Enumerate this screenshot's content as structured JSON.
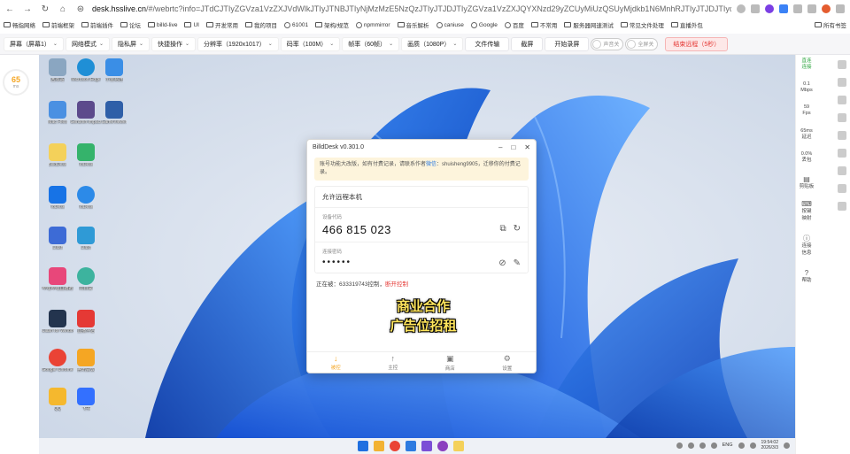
{
  "browser": {
    "url_host": "desk.hsslive.cn",
    "url_rest": "/#/webrtc?info=JTdCJTIyZGVza1VzZXJVdWlkJTIyJTNBJTIyNjMzMzE5NzQzJTIyJTJDJTIyZGVza1VzZXJQYXNzd29yZCUyMiUzQSUyMjdkb1N6MnhRJTIyJTJDJTIycmVtb3RlRGVza1VzZXJ..."
  },
  "bookmarks": {
    "items": [
      "畅指网络",
      "前端框架",
      "前端插件",
      "论坛",
      "billd-live",
      "UI",
      "开发常用",
      "我的项目",
      "61001",
      "架构/规范",
      "npmmirror",
      "音乐解析",
      "caniuse",
      "Google",
      "百度",
      "不常用",
      "服务器网速测试",
      "常见文件处理",
      "直播外包"
    ],
    "right": "所有书签"
  },
  "toolbar": {
    "screen": "屏幕（屏幕1）",
    "network": "网络模式",
    "privacy": "隐私屏",
    "shortcut": "快捷操作",
    "resolution": "分辨率（1920x1017）",
    "bitrate": "码率（100M）",
    "framerate": "帧率（60帧）",
    "quality": "画质（1080P）",
    "file_transfer": "文件传输",
    "screenshot": "截屏",
    "record": "开始录屏",
    "sound_toggle": "声音关",
    "fullscreen_toggle": "全屏关",
    "end_remote": "结束远程（5秒）"
  },
  "latency": {
    "value": "65",
    "unit": "ms"
  },
  "desktop_icons": [
    {
      "label": "回收站",
      "color": "#8aa6c1"
    },
    {
      "label": "Microsoft Edge",
      "color": "#1f8fd6"
    },
    {
      "label": "小鱼易连",
      "color": "#3a8ee6"
    },
    {
      "label": "Mac Files",
      "color": "#4a90e2"
    },
    {
      "label": "Genshin Impact",
      "color": "#5c4a8c"
    },
    {
      "label": "GameViewer",
      "color": "#2f5fa8"
    },
    {
      "label": "BilldDesk",
      "color": "#f4d15a"
    },
    {
      "label": "ToDesk",
      "color": "#35b36b"
    },
    {
      "label": "ToDesk",
      "color": "#1773e6"
    },
    {
      "label": "ToDesk",
      "color": "#2c8ae8"
    },
    {
      "label": "Clash",
      "color": "#3d6bd6"
    },
    {
      "label": "Clash",
      "color": "#2f9ad6"
    },
    {
      "label": "哔哩哔哩直播姬",
      "color": "#e8477a"
    },
    {
      "label": "向日葵",
      "color": "#3db39e"
    },
    {
      "label": "Clash for Windows",
      "color": "#23344e"
    },
    {
      "label": "直播伴侣",
      "color": "#e53935"
    },
    {
      "label": "Google Chrome",
      "color": "#ea4335"
    },
    {
      "label": "腾讯会议",
      "color": "#f5a623"
    },
    {
      "label": "QQ",
      "color": "#f5b82e"
    },
    {
      "label": "飞书",
      "color": "#3370ff"
    }
  ],
  "dialog": {
    "title": "BilldDesk v0.301.0",
    "notice_text": "账号功能大改版，如有付费记录，请联系作者",
    "notice_link": "微信",
    "notice_tail": "：shuisheng9905，迁移你的付费记录。",
    "allow_title": "允许远程本机",
    "device_code_label": "设备代码",
    "device_code": "466 815 023",
    "password_label": "连接密码",
    "password": "••••••",
    "status_prefix": "正在被：633319743控制，",
    "status_action": "断开控制",
    "ad_line1": "商业合作",
    "ad_line2": "广告位招租",
    "tabs": [
      {
        "icon": "↓",
        "label": "被控"
      },
      {
        "icon": "↑",
        "label": "主控"
      },
      {
        "icon": "▣",
        "label": "商店"
      },
      {
        "icon": "⚙",
        "label": "设置"
      }
    ]
  },
  "taskbar": {
    "lang": "ENG",
    "time": "19:54:02",
    "date": "2026/3/3"
  },
  "sidebar": {
    "mode_line1": "直连",
    "mode_line2": "连接",
    "bandwidth_value": "0.1",
    "bandwidth_unit": "Mbps",
    "fps_value": "59",
    "fps_unit": "Fps",
    "delay_value": "65ms",
    "delay_label": "延迟",
    "loss_value": "0.0%",
    "loss_label": "丢包",
    "clipboard": "剪贴板",
    "keymap_line1": "按键",
    "keymap_line2": "映射",
    "conn_line1": "连接",
    "conn_line2": "信息",
    "help": "帮助"
  }
}
